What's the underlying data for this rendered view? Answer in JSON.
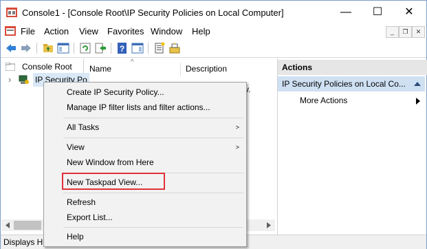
{
  "window": {
    "title": "Console1 - [Console Root\\IP Security Policies on Local Computer]"
  },
  "title_controls": {
    "minimize": "—",
    "maximize": "☐",
    "close": "✕"
  },
  "menubar": {
    "items": [
      "File",
      "Action",
      "View",
      "Favorites",
      "Window",
      "Help"
    ]
  },
  "mdi_controls": {
    "minimize": "_",
    "restore": "❐",
    "close": "✕"
  },
  "tree": {
    "root_label": "Console Root",
    "child_label": "IP Security Po",
    "expander": "›"
  },
  "list": {
    "columns": [
      "Name",
      "Description"
    ],
    "sort_glyph": "^",
    "partial_text": "v."
  },
  "actions": {
    "header": "Actions",
    "group_label": "IP Security Policies on Local Co...",
    "items": [
      "More Actions"
    ]
  },
  "context_menu": {
    "items": [
      {
        "label": "Create IP Security Policy...",
        "arrow": ""
      },
      {
        "label": "Manage IP filter lists and filter actions...",
        "arrow": ""
      },
      {
        "label": "All Tasks",
        "arrow": ">"
      },
      {
        "label": "View",
        "arrow": ">"
      },
      {
        "label": "New Window from Here",
        "arrow": ""
      },
      {
        "label": "New Taskpad View...",
        "arrow": ""
      },
      {
        "label": "Refresh",
        "arrow": ""
      },
      {
        "label": "Export List...",
        "arrow": ""
      },
      {
        "label": "Help",
        "arrow": ""
      }
    ]
  },
  "status": {
    "text": "Displays H"
  },
  "colors": {
    "highlight_border": "#e0303a",
    "action_group_bg": "#cfe0f3",
    "window_border": "#7a9cc9"
  }
}
